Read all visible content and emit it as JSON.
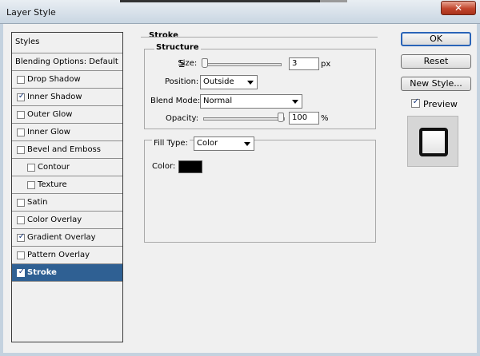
{
  "window": {
    "title": "Layer Style"
  },
  "styles_list": {
    "header": "Styles",
    "blending": "Blending Options: Default",
    "items": [
      {
        "label": "Drop Shadow",
        "checked": false
      },
      {
        "label": "Inner Shadow",
        "checked": true
      },
      {
        "label": "Outer Glow",
        "checked": false
      },
      {
        "label": "Inner Glow",
        "checked": false
      },
      {
        "label": "Bevel and Emboss",
        "checked": false
      },
      {
        "label": "Contour",
        "checked": false
      },
      {
        "label": "Texture",
        "checked": false
      },
      {
        "label": "Satin",
        "checked": false
      },
      {
        "label": "Color Overlay",
        "checked": false
      },
      {
        "label": "Gradient Overlay",
        "checked": true
      },
      {
        "label": "Pattern Overlay",
        "checked": false
      },
      {
        "label": "Stroke",
        "checked": true,
        "selected": true
      }
    ]
  },
  "stroke": {
    "title": "Stroke",
    "structure": {
      "title": "Structure",
      "size_label": "Size:",
      "size_value": "3",
      "size_unit": "px",
      "position_label": "Position:",
      "position_value": "Outside",
      "blend_label": "Blend Mode:",
      "blend_value": "Normal",
      "opacity_label": "Opacity:",
      "opacity_value": "100",
      "opacity_unit": "%"
    },
    "fill": {
      "fill_type_label": "Fill Type:",
      "fill_type_value": "Color",
      "color_label": "Color:",
      "color_hex": "#000000"
    }
  },
  "buttons": {
    "ok": "OK",
    "reset": "Reset",
    "new_style": "New Style...",
    "preview": "Preview",
    "preview_checked": true
  }
}
